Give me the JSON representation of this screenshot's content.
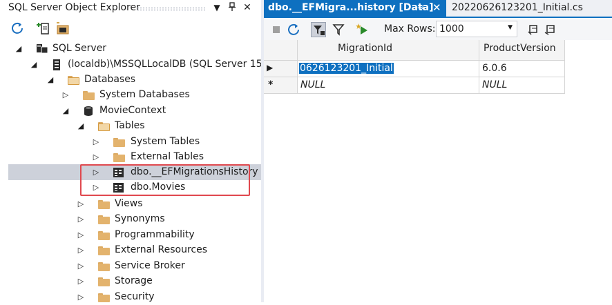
{
  "explorer": {
    "title": "SQL Server Object Explorer",
    "tree": [
      {
        "label": "SQL Server"
      },
      {
        "label": "(localdb)\\MSSQLLocalDB (SQL Server 15"
      },
      {
        "label": "Databases"
      },
      {
        "label": "System Databases"
      },
      {
        "label": "MovieContext"
      },
      {
        "label": "Tables"
      },
      {
        "label": "System Tables"
      },
      {
        "label": "External Tables"
      },
      {
        "label": "dbo.__EFMigrationsHistory"
      },
      {
        "label": "dbo.Movies"
      },
      {
        "label": "Views"
      },
      {
        "label": "Synonyms"
      },
      {
        "label": "Programmability"
      },
      {
        "label": "External Resources"
      },
      {
        "label": "Service Broker"
      },
      {
        "label": "Storage"
      },
      {
        "label": "Security"
      }
    ]
  },
  "editor": {
    "tabs": [
      {
        "label": "dbo.__EFMigra...history [Data]"
      },
      {
        "label": "20220626123201_Initial.cs"
      }
    ],
    "toolbar": {
      "max_rows_label": "Max Rows:",
      "max_rows_value": "1000"
    },
    "grid": {
      "columns": [
        "MigrationId",
        "ProductVersion"
      ],
      "rows": [
        {
          "marker": "▶",
          "cells": [
            "0626123201_Initial",
            "6.0.6"
          ]
        },
        {
          "marker": "*",
          "cells": [
            "NULL",
            "NULL"
          ]
        }
      ]
    }
  },
  "colors": {
    "accent": "#0e70c0",
    "highlight_box": "#e0484e",
    "folder": "#e3b36d"
  }
}
